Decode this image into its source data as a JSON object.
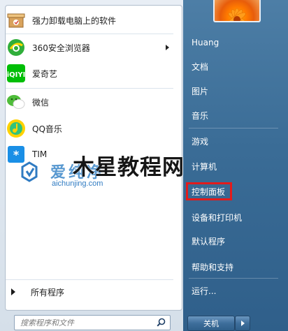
{
  "programs": [
    {
      "label": "强力卸载电脑上的软件",
      "icon": "uninstall-box-icon"
    },
    {
      "label": "360安全浏览器",
      "icon": "360-browser-icon",
      "has_submenu": true
    },
    {
      "label": "爱奇艺",
      "icon": "iqiyi-icon"
    },
    {
      "label": "微信",
      "icon": "wechat-icon"
    },
    {
      "label": "QQ音乐",
      "icon": "qq-music-icon"
    },
    {
      "label": "TIM",
      "icon": "tim-icon"
    }
  ],
  "all_programs_label": "所有程序",
  "search": {
    "placeholder": "搜索程序和文件"
  },
  "right_panel": {
    "user": "Huang",
    "items": [
      "文档",
      "图片",
      "音乐",
      "游戏",
      "计算机",
      "控制面板",
      "设备和打印机",
      "默认程序",
      "帮助和支持",
      "运行..."
    ],
    "highlighted_item": "控制面板",
    "highlight_color": "#e31b1b"
  },
  "shutdown_label": "关机",
  "watermark": {
    "site_cn": "爱纯净",
    "site_url": "aichunjing.com",
    "overlay_text": "木星教程网"
  },
  "colors": {
    "right_panel": "#3a6c96",
    "left_panel": "#ffffff"
  }
}
